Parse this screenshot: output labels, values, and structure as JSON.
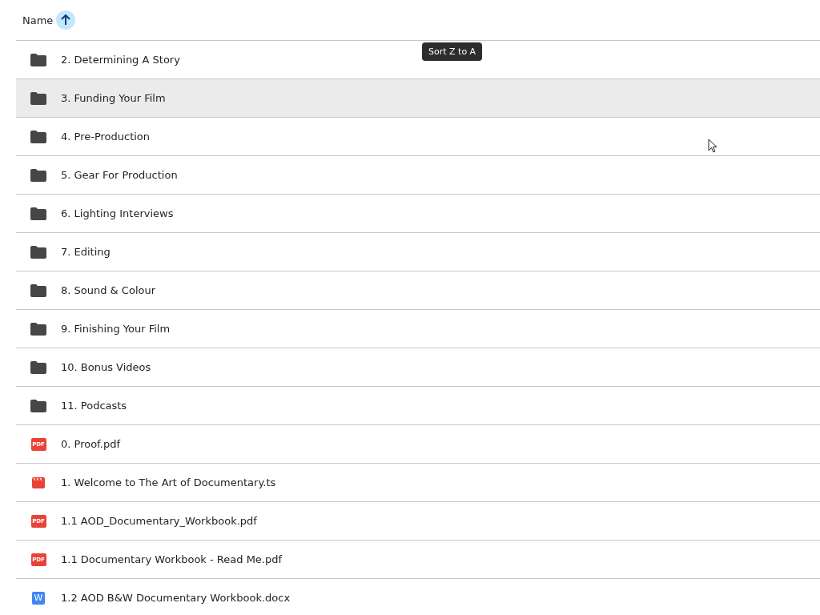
{
  "header": {
    "name_label": "Name",
    "sort_ascending": true
  },
  "tooltip": "Sort Z to A",
  "rows": [
    {
      "kind": "folder",
      "name": "2. Determining A Story",
      "selected": false
    },
    {
      "kind": "folder",
      "name": "3. Funding Your Film",
      "selected": true
    },
    {
      "kind": "folder",
      "name": "4. Pre-Production",
      "selected": false
    },
    {
      "kind": "folder",
      "name": "5. Gear For Production",
      "selected": false
    },
    {
      "kind": "folder",
      "name": "6. Lighting Interviews",
      "selected": false
    },
    {
      "kind": "folder",
      "name": "7. Editing",
      "selected": false
    },
    {
      "kind": "folder",
      "name": "8. Sound & Colour",
      "selected": false
    },
    {
      "kind": "folder",
      "name": "9. Finishing Your Film",
      "selected": false
    },
    {
      "kind": "folder",
      "name": "10. Bonus Videos",
      "selected": false
    },
    {
      "kind": "folder",
      "name": "11. Podcasts",
      "selected": false
    },
    {
      "kind": "pdf",
      "icon_label": "PDF",
      "name": "0. Proof.pdf",
      "selected": false
    },
    {
      "kind": "video",
      "name": "1. Welcome to The Art of Documentary.ts",
      "selected": false
    },
    {
      "kind": "pdf",
      "icon_label": "PDF",
      "name": "1.1 AOD_Documentary_Workbook.pdf",
      "selected": false
    },
    {
      "kind": "pdf",
      "icon_label": "PDF",
      "name": "1.1 Documentary Workbook - Read Me.pdf",
      "selected": false
    },
    {
      "kind": "doc",
      "icon_label": "W",
      "name": "1.2 AOD B&W Documentary Workbook.docx",
      "selected": false
    }
  ]
}
